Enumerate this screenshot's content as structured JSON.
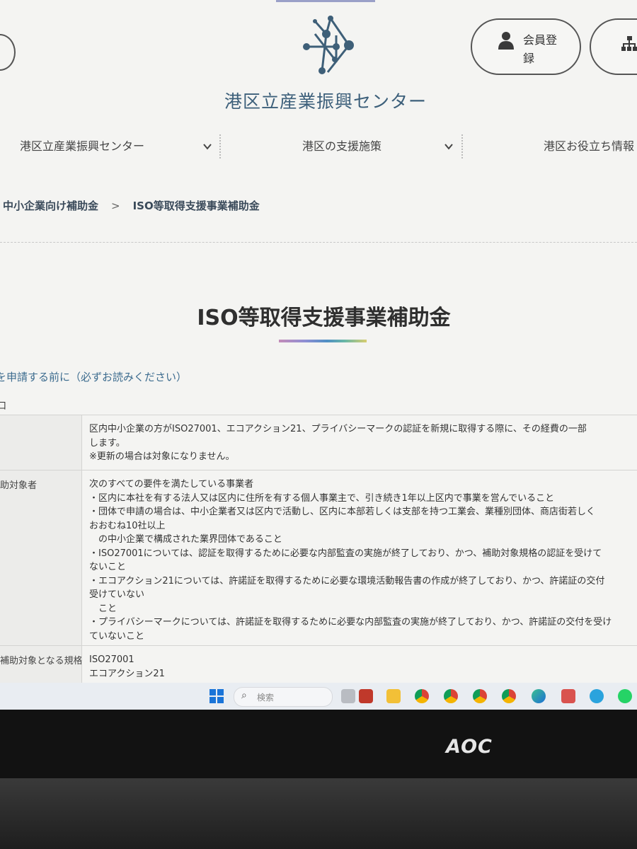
{
  "header": {
    "site_title": "港区立産業振興センター",
    "member_label": "会員登録"
  },
  "gnav": {
    "items": [
      {
        "label": "港区立産業振興センター"
      },
      {
        "label": "港区の支援施策"
      },
      {
        "label": "港区お役立ち情報"
      }
    ]
  },
  "breadcrumb": {
    "parent": "中小企業向け補助金",
    "separator": ">",
    "current": "ISO等取得支援事業補助金"
  },
  "page": {
    "title": "ISO等取得支援事業補助金",
    "notice_link": "を申請する前に（必ずお読みください）",
    "section_mark": "口"
  },
  "table": {
    "rows": [
      {
        "head": "",
        "lines": [
          "区内中小企業の方がISO27001、エコアクション21、プライバシーマークの認証を新規に取得する際に、その経費の一部",
          "します。",
          "※更新の場合は対象になりません。"
        ]
      },
      {
        "head": "助対象者",
        "lines": [
          "次のすべての要件を満たしている事業者",
          "・区内に本社を有する法人又は区内に住所を有する個人事業主で、引き続き1年以上区内で事業を営んでいること",
          "・団体で申請の場合は、中小企業者又は区内で活動し、区内に本部若しくは支部を持つ工業会、業種別団体、商店街若しく",
          "おおむね10社以上",
          "　の中小企業で構成された業界団体であること",
          "・ISO27001については、認証を取得するために必要な内部監査の実施が終了しており、かつ、補助対象規格の認証を受けて",
          "ないこと",
          "・エコアクション21については、許諾証を取得するために必要な環境活動報告書の作成が終了しており、かつ、許諾証の交付",
          "受けていない",
          "　こと",
          "・プライバシーマークについては、許諾証を取得するために必要な内部監査の実施が終了しており、かつ、許諾証の交付を受け",
          "ていないこと"
        ]
      },
      {
        "head": "補助対象となる規格",
        "lines": [
          "ISO27001",
          "エコアクション21"
        ]
      }
    ]
  },
  "taskbar": {
    "search_placeholder": "検索"
  },
  "monitor": {
    "brand": "AOC"
  },
  "colors": {
    "accent_title": "#3c5f7a",
    "background": "#f4f4f2",
    "taskbar": "#e9edf2",
    "bezel": "#121212"
  },
  "icons": [
    "logo-icon",
    "person-icon",
    "sitemap-icon",
    "chevron-down-icon",
    "windows-start-icon",
    "search-icon",
    "chrome-icon",
    "edge-icon",
    "folder-icon",
    "telegram-icon",
    "whatsapp-icon"
  ]
}
